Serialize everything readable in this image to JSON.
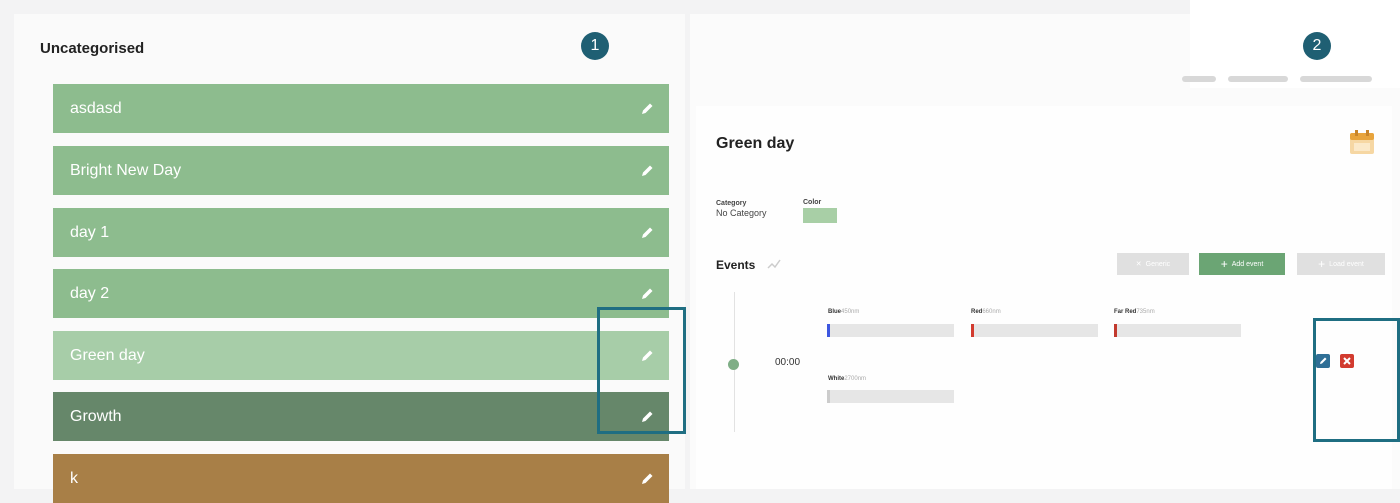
{
  "left": {
    "section_title": "Uncategorised",
    "badge": "1",
    "items": [
      {
        "label": "asdasd",
        "color": "#8dbc8e"
      },
      {
        "label": "Bright New Day",
        "color": "#8dbc8e"
      },
      {
        "label": "day 1",
        "color": "#8dbc8e"
      },
      {
        "label": "day 2",
        "color": "#8dbc8e"
      },
      {
        "label": "Green day",
        "color": "#a7cda8"
      },
      {
        "label": "Growth",
        "color": "#66876a"
      },
      {
        "label": "k",
        "color": "#a87f47"
      }
    ]
  },
  "right": {
    "badge": "2",
    "title": "Green day",
    "category_label": "Category",
    "category_value": "No Category",
    "color_label": "Color",
    "color_value": "#a8cfa6",
    "events_label": "Events",
    "buttons": {
      "left_label": "Generic",
      "add_label": "Add event",
      "right_label": "Load event"
    },
    "event": {
      "time": "00:00",
      "channels": [
        {
          "name": "Blue",
          "wavelength": "450nm",
          "color": "#3d57e0"
        },
        {
          "name": "Red",
          "wavelength": "660nm",
          "color": "#d23b2f"
        },
        {
          "name": "Far Red",
          "wavelength": "735nm",
          "color": "#c23a2e"
        },
        {
          "name": "White",
          "wavelength": "2700nm",
          "color": "#cccccc"
        }
      ]
    }
  }
}
